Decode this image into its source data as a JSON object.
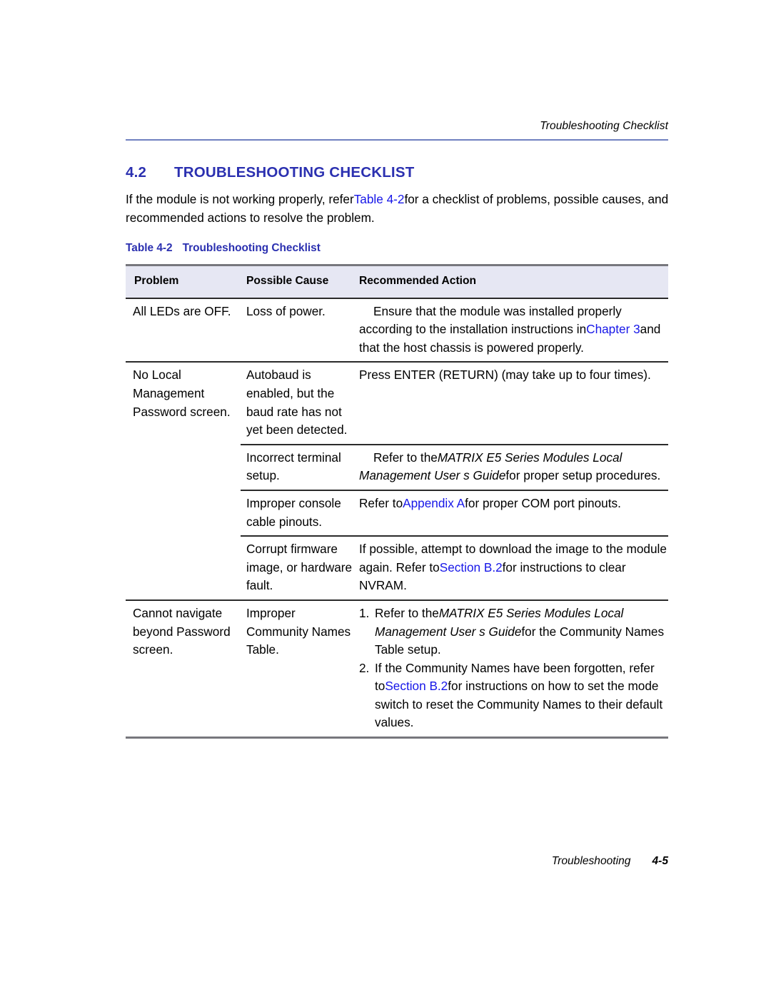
{
  "page": {
    "running_head": "Troubleshooting Checklist",
    "footer_chapter": "Troubleshooting",
    "footer_page": "4-5"
  },
  "section": {
    "number": "4.2",
    "title": "TROUBLESHOOTING CHECKLIST",
    "intro_part1": "If the module is not working properly, refer",
    "intro_link": "Table 4-2",
    "intro_part2": "for a checklist of problems, possible causes, and recommended actions to resolve the problem."
  },
  "table": {
    "caption_number": "Table 4-2",
    "caption_title": "Troubleshooting Checklist",
    "columns": [
      "Problem",
      "Possible Cause",
      "Recommended Action"
    ],
    "rows": [
      {
        "problem": "All LEDs are OFF.",
        "cause": "Loss of power.",
        "action_part1": "Ensure that the module was installed properly according to the installation instructions in",
        "action_link": "Chapter 3",
        "action_part2": "and that the host chassis is powered properly."
      },
      {
        "problem": "No Local Management Password screen.",
        "cause": "Autobaud is enabled, but the baud rate has not yet been detected.",
        "action_part1": "Press ENTER (RETURN) (may take up to four times)."
      },
      {
        "problem": "",
        "cause": "Incorrect terminal setup.",
        "action_part1": "Refer to the",
        "action_italic": "MATRIX E5 Series Modules Local Management User s Guide",
        "action_part2": "for proper setup procedures."
      },
      {
        "problem": "",
        "cause": "Improper console cable pinouts.",
        "action_part1": "Refer to",
        "action_link": "Appendix A",
        "action_part2": "for proper COM port pinouts."
      },
      {
        "problem": "",
        "cause": "Corrupt firmware image, or hardware fault.",
        "action_part1": "If possible, attempt to download the image to the module again. Refer to",
        "action_link": "Section B.2",
        "action_part2": "for instructions to clear NVRAM."
      },
      {
        "problem": "Cannot navigate beyond Password screen.",
        "cause": "Improper Community Names Table.",
        "action_list": [
          {
            "num": "1.",
            "part1": "Refer to the",
            "italic": "MATRIX E5 Series Modules Local Management User s Guide",
            "part2": "for the Community Names Table setup."
          },
          {
            "num": "2.",
            "part1": "If the Community Names have been forgotten, refer to",
            "link": "Section B.2",
            "part2": "for instructions on how to set the mode switch to reset the Community Names to their default values."
          }
        ]
      }
    ]
  },
  "colors": {
    "heading_blue": "#2b30b0",
    "link_blue": "#1616e8",
    "rule_blue": "#6f80c0",
    "header_bg": "#e6e7f3",
    "rule_grey": "#77777d"
  }
}
